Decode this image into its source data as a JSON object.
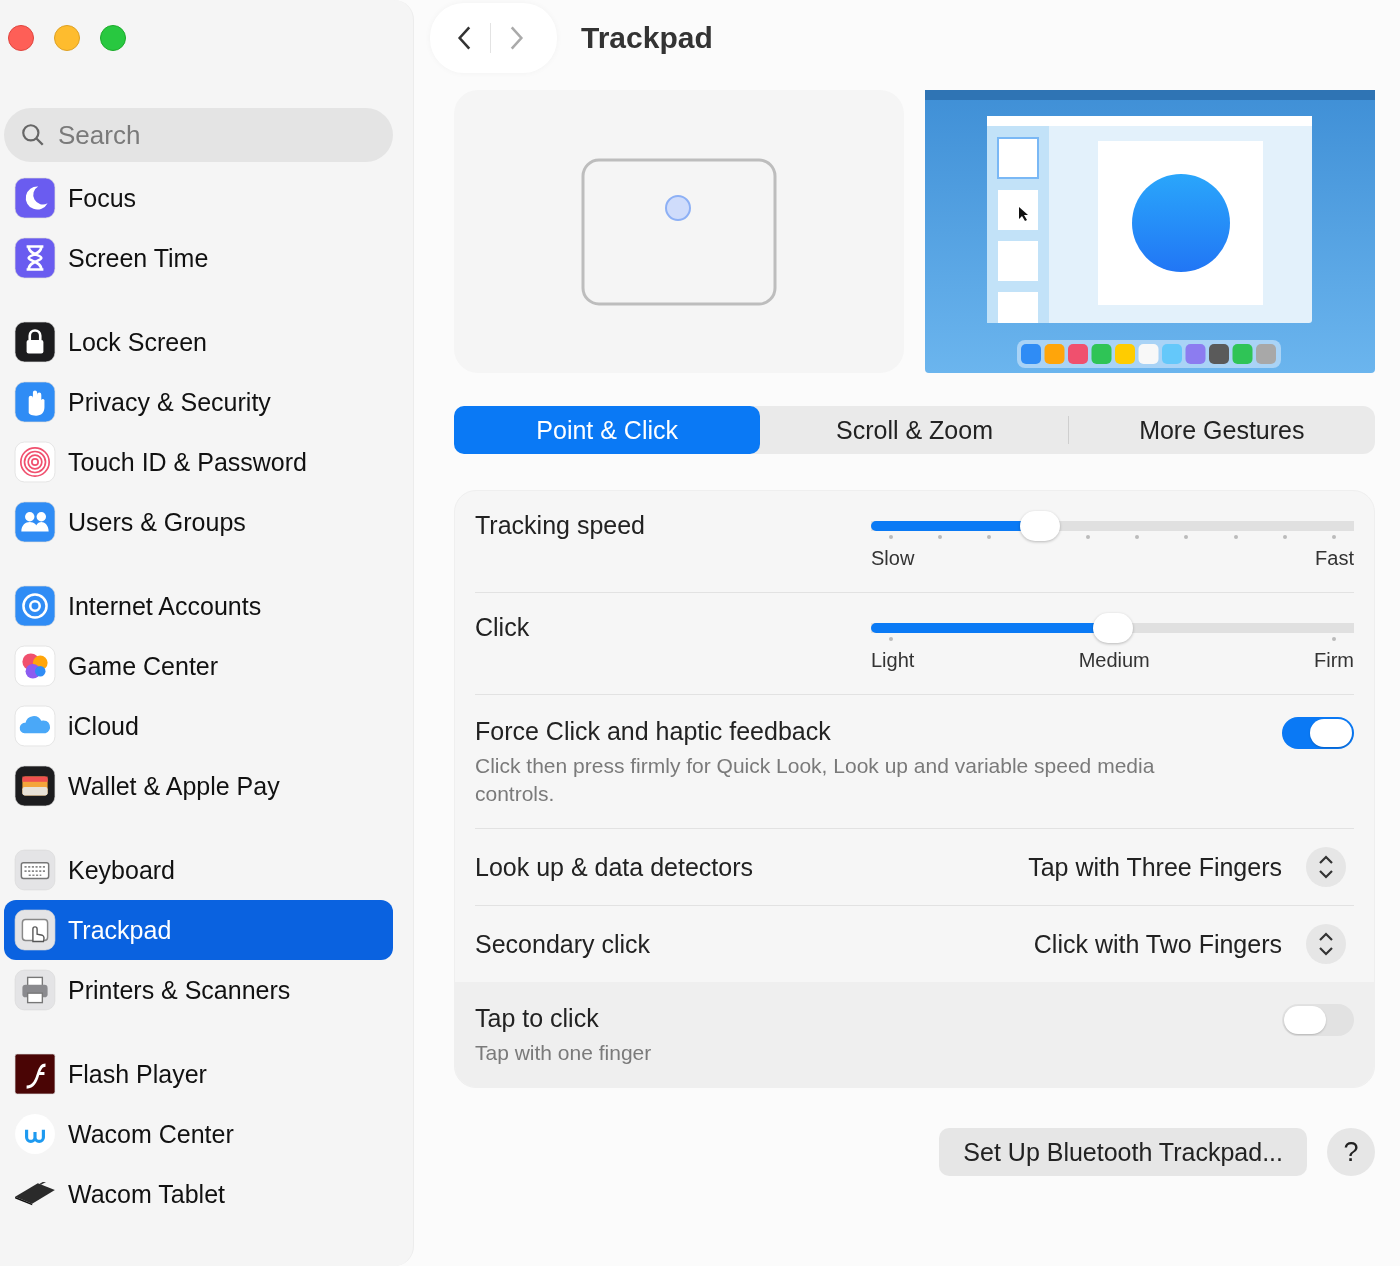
{
  "window": {
    "title": "Trackpad"
  },
  "sidebar": {
    "search": {
      "placeholder": "Search"
    },
    "groups": [
      [
        {
          "label": "Focus",
          "selected": false
        },
        {
          "label": "Screen Time",
          "selected": false
        }
      ],
      [
        {
          "label": "Lock Screen",
          "selected": false
        },
        {
          "label": "Privacy & Security",
          "selected": false
        },
        {
          "label": "Touch ID & Password",
          "selected": false
        },
        {
          "label": "Users & Groups",
          "selected": false
        }
      ],
      [
        {
          "label": "Internet Accounts",
          "selected": false
        },
        {
          "label": "Game Center",
          "selected": false
        },
        {
          "label": "iCloud",
          "selected": false
        },
        {
          "label": "Wallet & Apple Pay",
          "selected": false
        }
      ],
      [
        {
          "label": "Keyboard",
          "selected": false
        },
        {
          "label": "Trackpad",
          "selected": true
        },
        {
          "label": "Printers & Scanners",
          "selected": false
        }
      ],
      [
        {
          "label": "Flash Player",
          "selected": false
        },
        {
          "label": "Wacom Center",
          "selected": false
        },
        {
          "label": "Wacom Tablet",
          "selected": false
        }
      ]
    ]
  },
  "tabs": [
    {
      "label": "Point & Click",
      "selected": true
    },
    {
      "label": "Scroll & Zoom",
      "selected": false
    },
    {
      "label": "More Gestures",
      "selected": false
    }
  ],
  "settings": [
    {
      "kind": "slider",
      "label": "Tracking speed",
      "level": 0.35,
      "marks": [
        "Slow",
        "Fast"
      ]
    },
    {
      "kind": "slider",
      "label": "Click",
      "level": 0.5,
      "marks": [
        "Light",
        "Medium",
        "Firm"
      ]
    },
    {
      "kind": "toggle",
      "label": "Force Click and haptic feedback",
      "description": "Click then press firmly for Quick Look, Look up and variable speed media controls.",
      "on": true
    },
    {
      "kind": "popup",
      "label": "Look up & data detectors",
      "value": "Tap with Three Fingers"
    },
    {
      "kind": "popup",
      "label": "Secondary click",
      "value": "Click with Two Fingers"
    }
  ],
  "tap_section": [
    {
      "kind": "toggle",
      "label": "Tap to click",
      "description": "Tap with one finger",
      "on": false
    }
  ],
  "buttons": {
    "setup": "Set Up Bluetooth Trackpad...",
    "help": "?"
  }
}
